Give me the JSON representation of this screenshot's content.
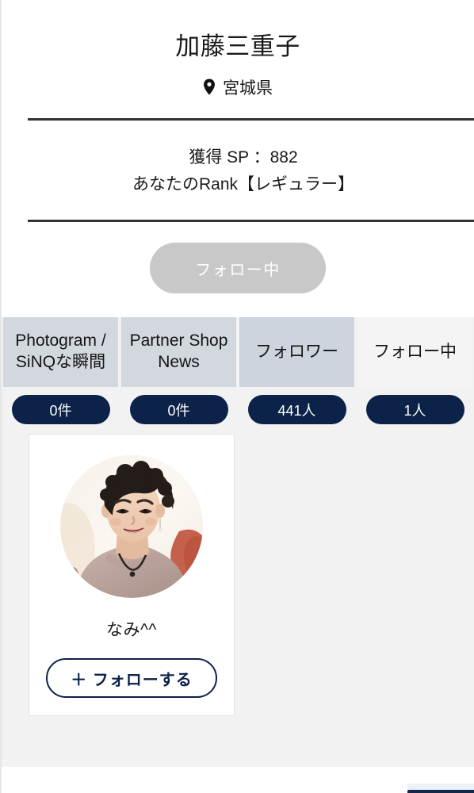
{
  "profile": {
    "name": "加藤三重子",
    "location_icon": "map-pin-icon",
    "location": "宮城県",
    "sp_line": "獲得 SP ：882",
    "rank_line": "あなたのRank【レギュラー】",
    "follow_state_label": "フォロー中"
  },
  "tabs": [
    {
      "label": "Photogram / SiNQな瞬間",
      "count": "0件",
      "active": false
    },
    {
      "label": "Partner Shop News",
      "count": "0件",
      "active": false
    },
    {
      "label": "フォロワー",
      "count": "441人",
      "active": false
    },
    {
      "label": "フォロー中",
      "count": "1人",
      "active": true
    }
  ],
  "cards": [
    {
      "name": "なみ^^",
      "avatar_alt": "portrait-photo",
      "follow_label": "＋ フォローする"
    }
  ],
  "colors": {
    "navy": "#0c2249",
    "tab_bg": "#d3d8df",
    "tab_active_bg": "#f4f4f4",
    "page_bg": "#f2f2f2",
    "follow_state_bg": "#c8c8c8",
    "divider": "#333333"
  }
}
